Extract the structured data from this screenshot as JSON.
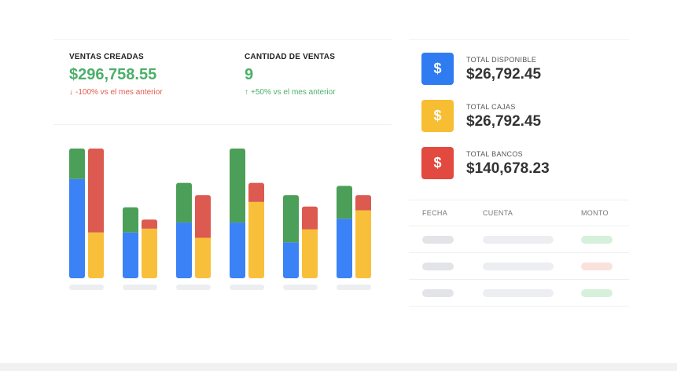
{
  "kpis": [
    {
      "title": "VENTAS CREADAS",
      "value": "$296,758.55",
      "change": "-100% vs el mes anterior",
      "direction": "down",
      "value_color": "#4caf6a",
      "change_color": "#e05a4f"
    },
    {
      "title": "CANTIDAD DE VENTAS",
      "value": "9",
      "change": "+50% vs el mes anterior",
      "direction": "up",
      "value_color": "#4caf6a",
      "change_color": "#4caf6a"
    }
  ],
  "summary": [
    {
      "label": "TOTAL DISPONIBLE",
      "value": "$26,792.45",
      "icon": "$",
      "color": "#2f7cf2"
    },
    {
      "label": "TOTAL  CAJAS",
      "value": "$26,792.45",
      "icon": "$",
      "color": "#f7be34"
    },
    {
      "label": "TOTAL  BANCOS",
      "value": "$140,678.23",
      "icon": "$",
      "color": "#e24a3f"
    }
  ],
  "table": {
    "headers": [
      "FECHA",
      "CUENTA",
      "MONTO"
    ],
    "placeholder_rows": 3,
    "monto_colors": [
      "#d6f0dc",
      "#fbe1dc",
      "#d6f0dc"
    ]
  },
  "chart_data": {
    "type": "bar",
    "stacked": true,
    "group_count": 6,
    "colors": {
      "blue": "#3b82f6",
      "yellow": "#f8c03a",
      "green": "#4c9f58",
      "red": "#dc5a4f"
    },
    "groups": [
      {
        "left": [
          {
            "color": "blue",
            "value": 130
          },
          {
            "color": "green",
            "value": 40
          }
        ],
        "right": [
          {
            "color": "yellow",
            "value": 60
          },
          {
            "color": "red",
            "value": 110
          }
        ]
      },
      {
        "left": [
          {
            "color": "blue",
            "value": 60
          },
          {
            "color": "green",
            "value": 33
          }
        ],
        "right": [
          {
            "color": "yellow",
            "value": 65
          },
          {
            "color": "red",
            "value": 12
          }
        ]
      },
      {
        "left": [
          {
            "color": "blue",
            "value": 73
          },
          {
            "color": "green",
            "value": 52
          }
        ],
        "right": [
          {
            "color": "yellow",
            "value": 53
          },
          {
            "color": "red",
            "value": 56
          }
        ]
      },
      {
        "left": [
          {
            "color": "blue",
            "value": 73
          },
          {
            "color": "green",
            "value": 97
          }
        ],
        "right": [
          {
            "color": "yellow",
            "value": 100
          },
          {
            "color": "red",
            "value": 25
          }
        ]
      },
      {
        "left": [
          {
            "color": "blue",
            "value": 47
          },
          {
            "color": "green",
            "value": 62
          }
        ],
        "right": [
          {
            "color": "yellow",
            "value": 64
          },
          {
            "color": "red",
            "value": 30
          }
        ]
      },
      {
        "left": [
          {
            "color": "blue",
            "value": 78
          },
          {
            "color": "green",
            "value": 43
          }
        ],
        "right": [
          {
            "color": "yellow",
            "value": 89
          },
          {
            "color": "red",
            "value": 20
          }
        ]
      }
    ],
    "ylim": [
      0,
      175
    ]
  }
}
